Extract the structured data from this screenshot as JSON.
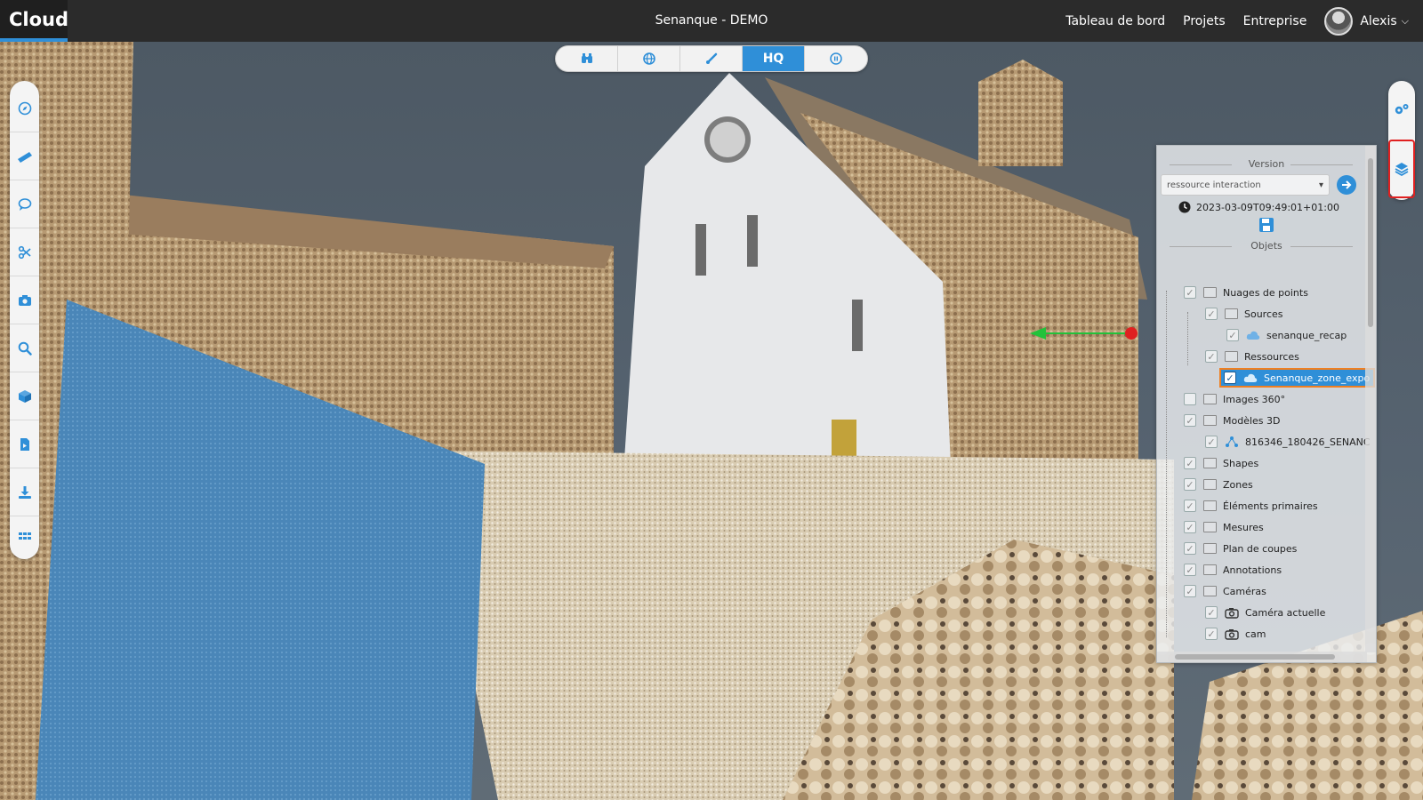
{
  "app": {
    "logo": "Cloud",
    "title": "Senanque - DEMO"
  },
  "nav": {
    "dashboard": "Tableau de bord",
    "projects": "Projets",
    "company": "Entreprise",
    "user_name": "Alexis"
  },
  "modebar": {
    "hq_label": "HQ",
    "icons": [
      "binoculars-icon",
      "globe-icon",
      "brush-icon",
      "hq",
      "pause-circle-icon"
    ],
    "active": "HQ"
  },
  "left_tools": [
    "compass-icon",
    "ruler-icon",
    "comment-icon",
    "scissors-icon",
    "camera-icon",
    "search-icon",
    "cube-icon",
    "file-export-icon",
    "download-icon",
    "grid-icon"
  ],
  "right_tools": [
    "settings-icon",
    "layers-icon"
  ],
  "panel": {
    "version_heading": "Version",
    "version_select": "ressource interaction",
    "timestamp": "2023-03-09T09:49:01+01:00",
    "objects_heading": "Objets",
    "tree": [
      {
        "label": "Nuages de points",
        "level": 0,
        "checked": true,
        "type": "folder"
      },
      {
        "label": "Sources",
        "level": 1,
        "checked": true,
        "type": "folder"
      },
      {
        "label": "senanque_recap",
        "level": 2,
        "checked": true,
        "type": "cloud"
      },
      {
        "label": "Ressources",
        "level": 1,
        "checked": true,
        "type": "folder"
      },
      {
        "label": "Senanque_zone_expo",
        "level": 2,
        "checked": true,
        "type": "cloud",
        "selected": true
      },
      {
        "label": "Images 360°",
        "level": 0,
        "checked": false,
        "type": "folder"
      },
      {
        "label": "Modèles 3D",
        "level": 0,
        "checked": true,
        "type": "folder"
      },
      {
        "label": "816346_180426_SENANC",
        "level": 1,
        "checked": true,
        "type": "model"
      },
      {
        "label": "Shapes",
        "level": 0,
        "checked": true,
        "type": "folder"
      },
      {
        "label": "Zones",
        "level": 0,
        "checked": true,
        "type": "folder"
      },
      {
        "label": "Éléments primaires",
        "level": 0,
        "checked": true,
        "type": "folder"
      },
      {
        "label": "Mesures",
        "level": 0,
        "checked": true,
        "type": "folder"
      },
      {
        "label": "Plan de coupes",
        "level": 0,
        "checked": true,
        "type": "folder"
      },
      {
        "label": "Annotations",
        "level": 0,
        "checked": true,
        "type": "folder"
      },
      {
        "label": "Caméras",
        "level": 0,
        "checked": true,
        "type": "folder"
      },
      {
        "label": "Caméra actuelle",
        "level": 1,
        "checked": true,
        "type": "camera"
      },
      {
        "label": "cam",
        "level": 1,
        "checked": true,
        "type": "camera"
      }
    ]
  },
  "colors": {
    "accent": "#2f8fd8",
    "topbar": "#2b2b2b",
    "highlight_border": "#f07f20",
    "selected_tool_border": "#e02020"
  }
}
